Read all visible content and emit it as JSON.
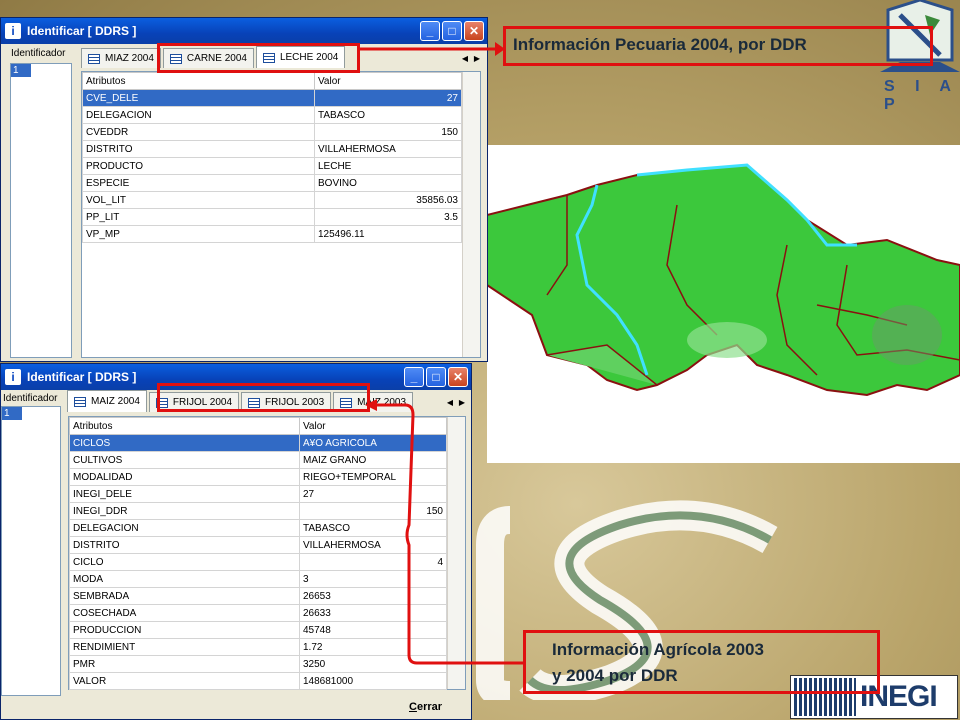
{
  "win1": {
    "title": "Identificar [ DDRS ]",
    "id_label": "Identificador",
    "id_item": "1",
    "tabs": [
      "MIAZ 2004",
      "CARNE 2004",
      "LECHE 2004"
    ],
    "headers": [
      "Atributos",
      "Valor"
    ],
    "rows": [
      [
        "CVE_DELE",
        "27",
        "num"
      ],
      [
        "DELEGACION",
        "TABASCO",
        ""
      ],
      [
        "CVEDDR",
        "150",
        "num"
      ],
      [
        "DISTRITO",
        "VILLAHERMOSA",
        ""
      ],
      [
        "PRODUCTO",
        "LECHE",
        ""
      ],
      [
        "ESPECIE",
        "BOVINO",
        ""
      ],
      [
        "VOL_LIT",
        "35856.03",
        "num"
      ],
      [
        "PP_LIT",
        "3.5",
        "num"
      ],
      [
        "VP_MP",
        "125496.11",
        ""
      ]
    ]
  },
  "win2": {
    "title": "Identificar [ DDRS ]",
    "id_label": "Identificador",
    "id_item": "1",
    "tabs": [
      "MAIZ 2004",
      "FRIJOL 2004",
      "FRIJOL 2003",
      "MAIZ 2003"
    ],
    "headers": [
      "Atributos",
      "Valor"
    ],
    "rows": [
      [
        "CICLOS",
        "A¥O AGRICOLA",
        ""
      ],
      [
        "CULTIVOS",
        "MAIZ GRANO",
        ""
      ],
      [
        "MODALIDAD",
        "RIEGO+TEMPORAL",
        ""
      ],
      [
        "INEGI_DELE",
        "27",
        ""
      ],
      [
        "INEGI_DDR",
        "150",
        "num"
      ],
      [
        "DELEGACION",
        "TABASCO",
        ""
      ],
      [
        "DISTRITO",
        "VILLAHERMOSA",
        ""
      ],
      [
        "CICLO",
        "4",
        "num"
      ],
      [
        "MODA",
        "3",
        ""
      ],
      [
        "SEMBRADA",
        "26653",
        ""
      ],
      [
        "COSECHADA",
        "26633",
        ""
      ],
      [
        "PRODUCCION",
        "45748",
        ""
      ],
      [
        "RENDIMIENT",
        "1.72",
        ""
      ],
      [
        "PMR",
        "3250",
        ""
      ],
      [
        "VALOR",
        "148681000",
        ""
      ]
    ],
    "close_label_underlined": "C",
    "close_label_rest": "errar"
  },
  "callout_top": "Información Pecuaria 2004, por DDR",
  "callout_bottom_line1": "Información Agrícola  2003",
  "callout_bottom_line2": "y 2004 por DDR",
  "logo_siap": "S I A P",
  "logo_inegi": "INEGI",
  "colors": {
    "accent": "#e01010",
    "selection": "#316ac5",
    "map_green": "#3cc83c"
  }
}
